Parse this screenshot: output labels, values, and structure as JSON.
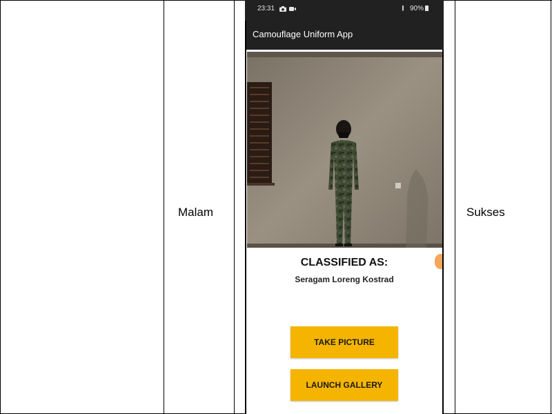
{
  "table": {
    "col2_text": "Malam",
    "col4_text": "Sukses"
  },
  "phone": {
    "status_bar": {
      "time": "23:31",
      "battery": "90%"
    },
    "app_bar": {
      "title": "Camouflage Uniform App"
    },
    "result": {
      "heading": "CLASSIFIED AS:",
      "value": "Seragam Loreng Kostrad"
    },
    "buttons": {
      "take_picture": "TAKE PICTURE",
      "launch_gallery": "LAUNCH GALLERY"
    },
    "icons": [
      "camera-icon",
      "video-icon",
      "signal-icon",
      "battery-icon"
    ],
    "colors": {
      "app_bar": "#212121",
      "button": "#f5b400"
    }
  }
}
